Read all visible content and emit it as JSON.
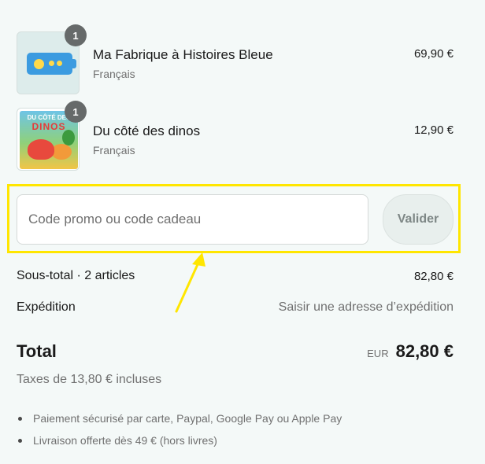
{
  "cart": {
    "items": [
      {
        "name": "Ma Fabrique à Histoires Bleue",
        "variant": "Français",
        "price": "69,90 €",
        "quantity": "1",
        "thumbnail": "device-image"
      },
      {
        "name": "Du côté des dinos",
        "variant": "Français",
        "price": "12,90 €",
        "quantity": "1",
        "thumbnail": "book-cover-image",
        "cover_text_top": "DU CÔTÉ DES",
        "cover_text_main": "DINOS"
      }
    ]
  },
  "promo": {
    "placeholder": "Code promo ou code cadeau",
    "button_label": "Valider",
    "highlight_color": "#ffe600"
  },
  "summary": {
    "subtotal_label": "Sous-total · 2 articles",
    "subtotal_value": "82,80 €",
    "shipping_label": "Expédition",
    "shipping_value": "Saisir une adresse d’expédition",
    "total_label": "Total",
    "currency": "EUR",
    "total_value": "82,80 €",
    "tax_text": "Taxes de 13,80 € incluses"
  },
  "perks": [
    "Paiement sécurisé par carte, Paypal, Google Pay ou Apple Pay",
    "Livraison offerte dès 49 € (hors livres)"
  ],
  "colors": {
    "background": "#f4f9f8",
    "annotation": "#ffe600"
  }
}
